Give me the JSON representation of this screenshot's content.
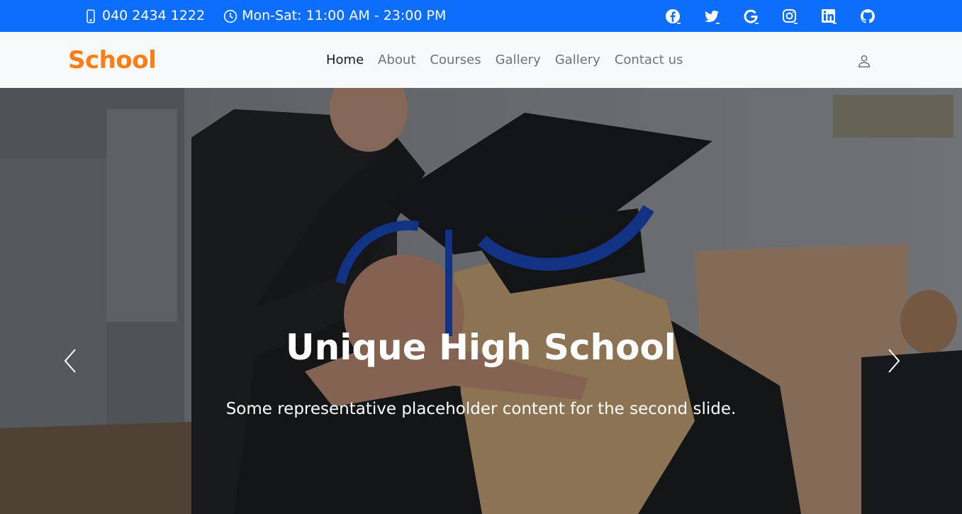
{
  "topbar": {
    "phone": "040 2434 1222",
    "hours": "Mon-Sat: 11:00 AM - 23:00 PM",
    "phone_icon": "mobile-phone-icon",
    "hours_icon": "clock-icon",
    "social": [
      "facebook-icon",
      "twitter-icon",
      "google-icon",
      "instagram-icon",
      "linkedin-icon",
      "github-icon"
    ],
    "color": "#0d6efd"
  },
  "navbar": {
    "brand": "School",
    "brand_color": "#fd7e14",
    "links": [
      {
        "label": "Home",
        "active": true
      },
      {
        "label": "About"
      },
      {
        "label": "Courses"
      },
      {
        "label": "Gallery"
      },
      {
        "label": "Gallery"
      },
      {
        "label": "Contact us"
      }
    ],
    "user_icon": "user-icon"
  },
  "hero": {
    "title": "Unique High School",
    "subtitle": "Some representative placeholder content for the second slide.",
    "prev_icon": "chevron-left-icon",
    "next_icon": "chevron-right-icon"
  }
}
